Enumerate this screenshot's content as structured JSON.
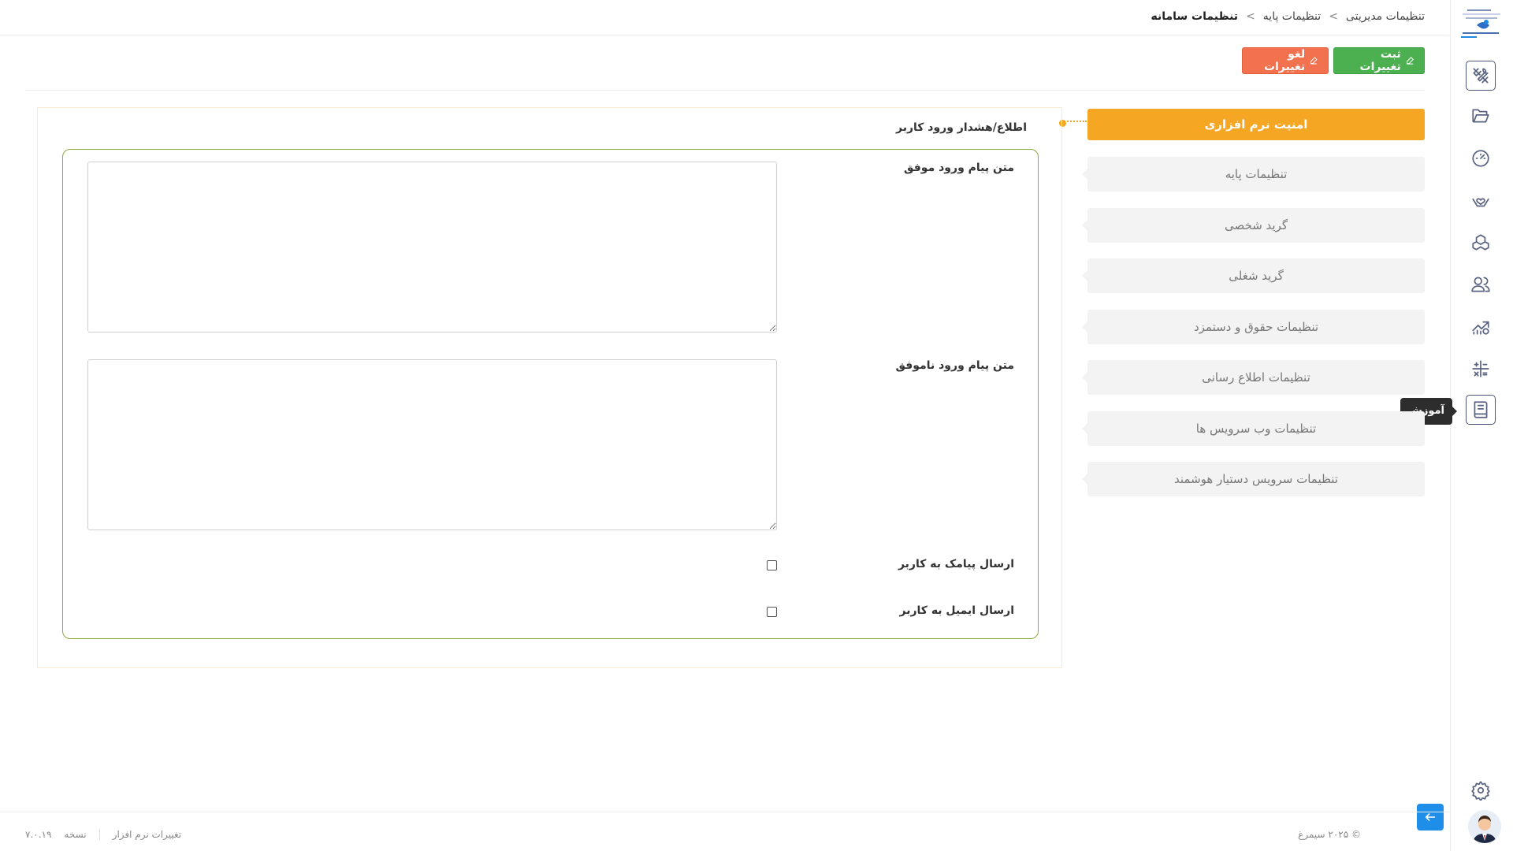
{
  "breadcrumb": {
    "items": [
      "تنظیمات مدیریتی",
      "تنظیمات پایه"
    ],
    "current": "تنظیمات سامانه",
    "separator": ">"
  },
  "toolbar": {
    "save_label": "ثبت تغییرات",
    "cancel_label": "لغو تغییرات"
  },
  "menu": {
    "items": [
      {
        "label": "امنیت نرم افزاری",
        "active": true
      },
      {
        "label": "تنظیمات پایه"
      },
      {
        "label": "گرید شخصی"
      },
      {
        "label": "گرید شغلی"
      },
      {
        "label": "تنظیمات حقوق و دستمزد"
      },
      {
        "label": "تنظیمات اطلاع رسانی"
      },
      {
        "label": "تنظیمات وب سرویس ها"
      },
      {
        "label": "تنظیمات سرویس دستیار هوشمند"
      }
    ]
  },
  "panel": {
    "title": "اطلاع/هشدار ورود کاربر",
    "success_label": "متن پیام ورود موفق",
    "success_value": "",
    "failure_label": "متن پیام ورود ناموفق",
    "failure_value": "",
    "sms_label": "ارسال پیامک به کاربر",
    "sms_checked": false,
    "email_label": "ارسال ایمیل به کاربر",
    "email_checked": false
  },
  "rail": {
    "icons": [
      "tools-icon",
      "folder-icon",
      "dashboard-gauge-icon",
      "hand-heart-icon",
      "boxes-icon",
      "users-icon",
      "chart-money-icon",
      "calculator-icon",
      "book-icon",
      "settings-icon"
    ],
    "active": "book-icon",
    "tooltip": "آموزش"
  },
  "footer": {
    "copyright": "© ۲۰۲۵ سیمرغ",
    "changes_link": "تغییرات نرم افزار",
    "version_label": "نسخه",
    "version_value": "۷.۰.۱۹"
  },
  "colors": {
    "accent": "#f5a623",
    "save": "#4caf50",
    "cancel": "#f2714e",
    "fieldset_border": "#8bab3c",
    "rail_icon": "#5a6482"
  }
}
